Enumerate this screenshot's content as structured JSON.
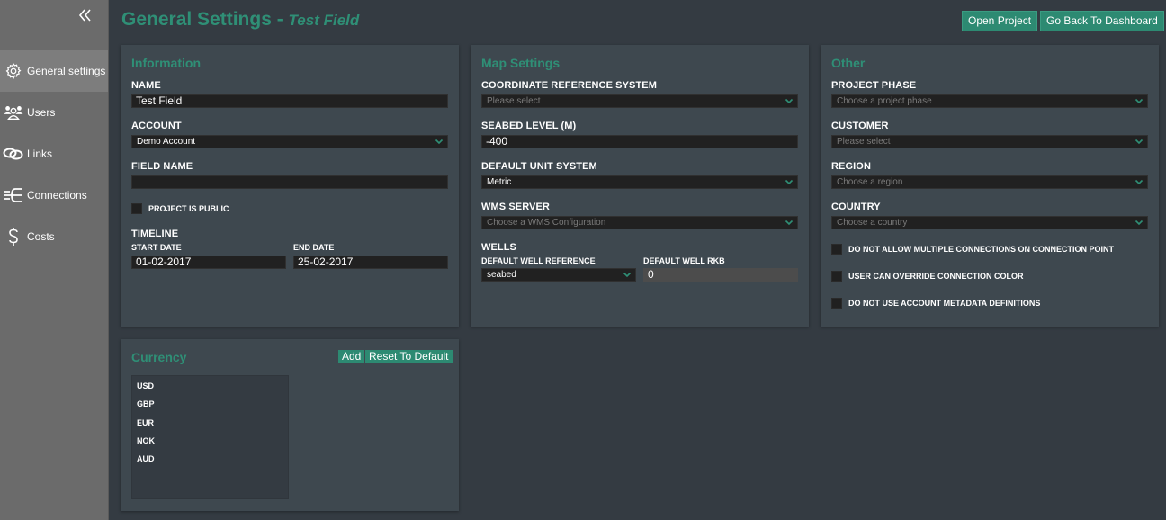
{
  "colors": {
    "accent": "#2f8f76",
    "button": "#2d8a72",
    "sidebar": "#6b6b6b",
    "background": "#343b42",
    "panel": "#3e484f"
  },
  "sidebar": {
    "collapse_icon": "double-chevron-left",
    "items": [
      {
        "label": "General settings",
        "icon": "gear-icon",
        "active": true
      },
      {
        "label": "Users",
        "icon": "users-icon",
        "active": false
      },
      {
        "label": "Links",
        "icon": "link-icon",
        "active": false
      },
      {
        "label": "Connections",
        "icon": "connections-icon",
        "active": false
      },
      {
        "label": "Costs",
        "icon": "dollar-icon",
        "active": false
      }
    ]
  },
  "header": {
    "title": "General Settings - ",
    "subtitle": "Test Field",
    "open_project": "Open Project",
    "back_dashboard": "Go Back To Dashboard"
  },
  "information": {
    "title": "Information",
    "name_label": "NAME",
    "name_value": "Test Field",
    "account_label": "ACCOUNT",
    "account_value": "Demo Account",
    "field_name_label": "FIELD NAME",
    "field_name_value": "",
    "public_label": "PROJECT IS PUBLIC",
    "public_checked": false,
    "timeline_label": "TIMELINE",
    "start_label": "START DATE",
    "start_value": "01-02-2017",
    "end_label": "END DATE",
    "end_value": "25-02-2017"
  },
  "map": {
    "title": "Map Settings",
    "crs_label": "COORDINATE REFERENCE SYSTEM",
    "crs_placeholder": "Please select",
    "seabed_label": "SEABED LEVEL (M)",
    "seabed_value": "-400",
    "unit_label": "DEFAULT UNIT SYSTEM",
    "unit_value": "Metric",
    "wms_label": "WMS SERVER",
    "wms_placeholder": "Choose a WMS Configuration",
    "wells_label": "WELLS",
    "well_ref_label": "DEFAULT WELL REFERENCE",
    "well_ref_value": "seabed",
    "well_rkb_label": "DEFAULT WELL RKB",
    "well_rkb_value": "0"
  },
  "other": {
    "title": "Other",
    "phase_label": "PROJECT PHASE",
    "phase_placeholder": "Choose a project phase",
    "customer_label": "CUSTOMER",
    "customer_placeholder": "Please select",
    "region_label": "REGION",
    "region_placeholder": "Choose a region",
    "country_label": "COUNTRY",
    "country_placeholder": "Choose a country",
    "checks": [
      {
        "label": "DO NOT ALLOW MULTIPLE CONNECTIONS ON CONNECTION POINT",
        "checked": false
      },
      {
        "label": "USER CAN OVERRIDE CONNECTION COLOR",
        "checked": false
      },
      {
        "label": "DO NOT USE ACCOUNT METADATA DEFINITIONS",
        "checked": false
      }
    ]
  },
  "currency": {
    "title": "Currency",
    "add": "Add",
    "reset": "Reset To Default",
    "items": [
      "USD",
      "GBP",
      "EUR",
      "NOK",
      "AUD"
    ]
  }
}
